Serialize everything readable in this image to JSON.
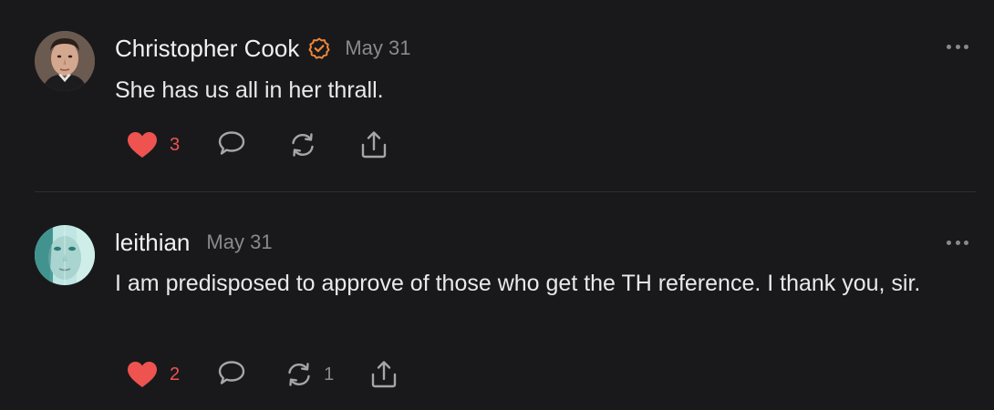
{
  "comments": [
    {
      "author": "Christopher Cook",
      "verified": true,
      "date": "May 31",
      "text": "She has us all in her thrall.",
      "likes": "3",
      "restacks": "",
      "avatar_icon": "person-portrait-avatar"
    },
    {
      "author": "leithian",
      "verified": false,
      "date": "May 31",
      "text": "I am predisposed to approve of those who get the TH reference. I thank you, sir.",
      "likes": "2",
      "restacks": "1",
      "avatar_icon": "teal-portrait-avatar"
    }
  ],
  "colors": {
    "background": "#19191b",
    "like": "#ee5350",
    "verified": "#f0873a",
    "muted": "#8a8a8e",
    "text": "#e9e9ea"
  },
  "icons": [
    "verified-badge-icon",
    "heart-icon",
    "comment-bubble-icon",
    "restack-icon",
    "share-icon",
    "more-dots-icon"
  ]
}
